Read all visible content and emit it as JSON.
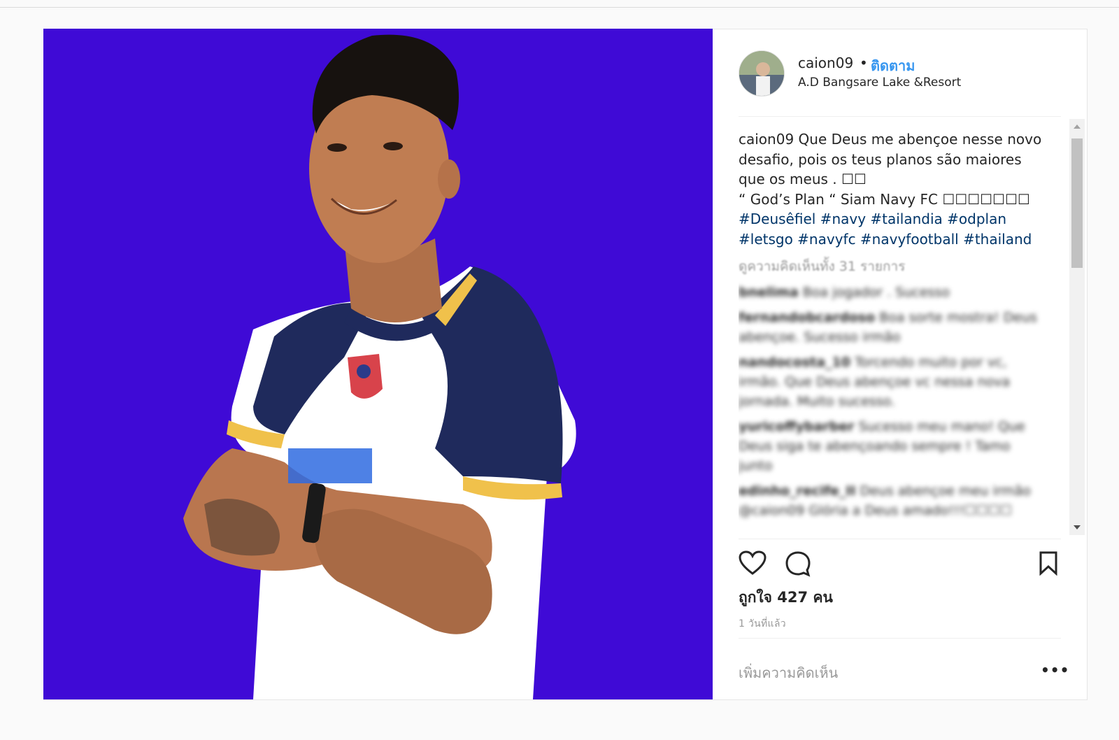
{
  "post": {
    "username": "caion09",
    "dot": "•",
    "follow_label": "ติดตาม",
    "location": "A.D Bangsare Lake &Resort",
    "caption_user": "caion09",
    "caption_text": " Que Deus me abençoe nesse novo desafio, pois os teus planos são maiores que os meus . ☐☐\n“ God’s Plan “ Siam Navy FC ☐☐☐☐☐☐☐",
    "hashtags_line1": "#Deusêfiel #navy #tailandia #odplan",
    "hashtags_line2": "#letsgo #navyfc #navyfootball #thailand",
    "view_all_comments": "ดูความคิดเห็นทั้ง 31 รายการ",
    "comments": [
      {
        "user": "bnelima",
        "text": "Boa jogador . Sucesso"
      },
      {
        "user": "fernandobcardoso",
        "text": "Boa sorte mostra! Deus abençoe. Sucesso irmão"
      },
      {
        "user": "nandocosta_10",
        "text": "Torcendo muito por vc, irmão. Que Deus abençoe vc nessa nova jornada. Muito sucesso."
      },
      {
        "user": "yuricoffybarber",
        "text": "Sucesso meu mano! Que Deus siga te abençoando sempre ! Tamo junto"
      },
      {
        "user": "edinho_recife_II",
        "text": "Deus abençoe meu irmão @caion09 Glória a Deus amado!!!☐☐☐☐"
      }
    ],
    "likes_text": "ถูกใจ 427 คน",
    "time_ago": "1 วันที่แล้ว",
    "add_comment_placeholder": "เพิ่มความคิดเห็น",
    "more_label": "•••"
  },
  "icons": {
    "like": "heart-icon",
    "comment": "comment-bubble-icon",
    "save": "bookmark-icon",
    "more": "more-options-icon"
  },
  "colors": {
    "photo_background": "#3f0ad6",
    "follow_link": "#3897f0",
    "hashtag": "#003569"
  }
}
